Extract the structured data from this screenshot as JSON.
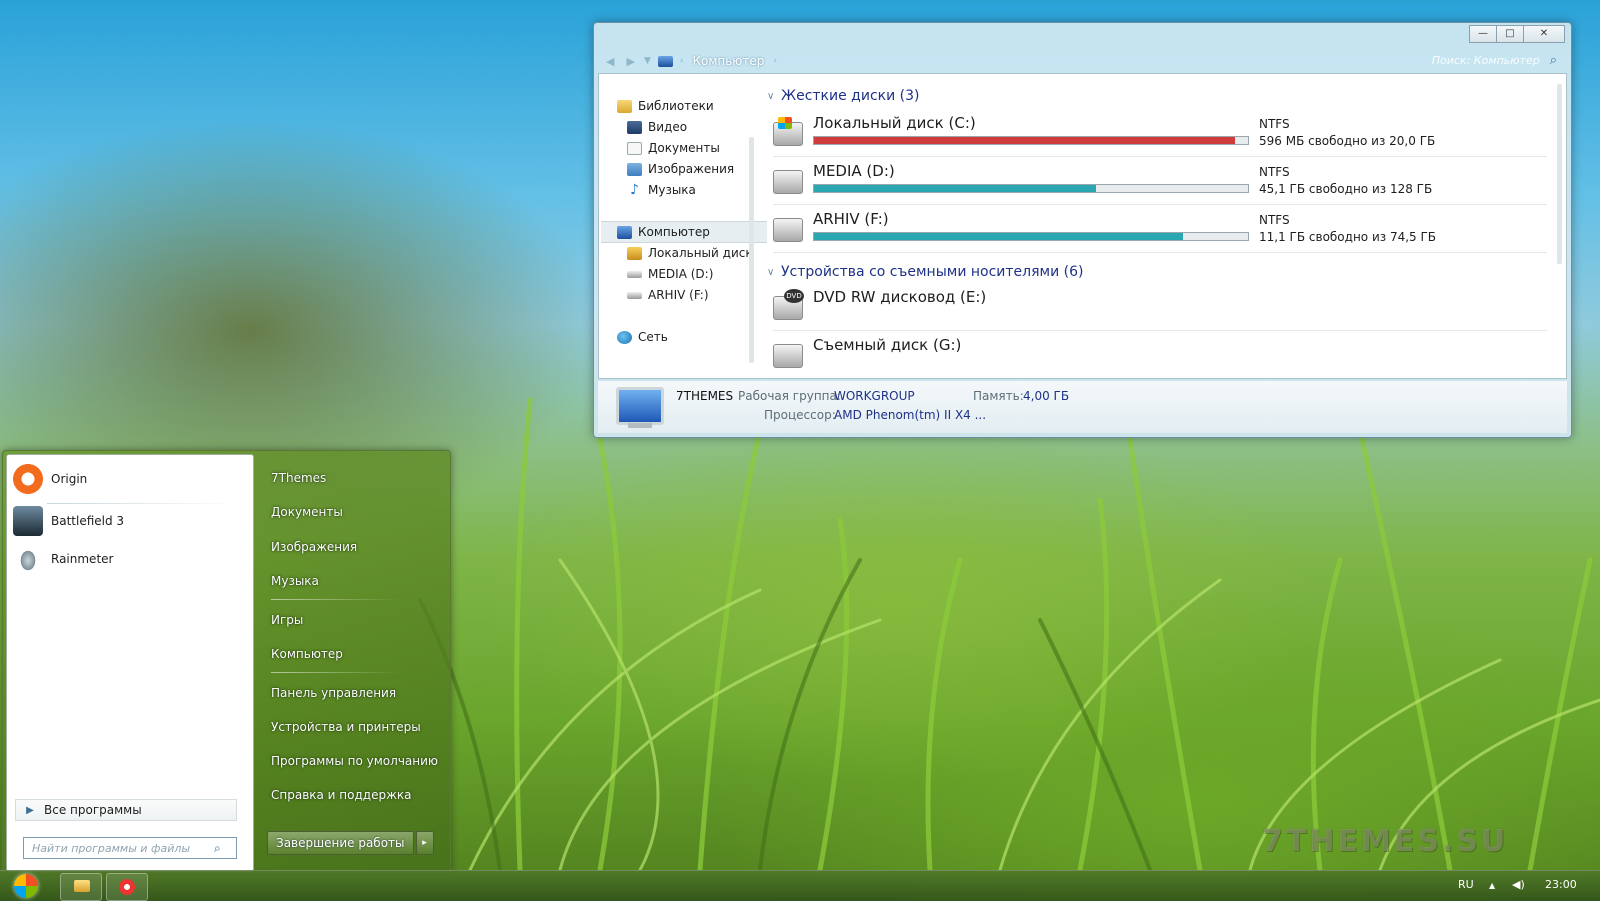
{
  "explorer": {
    "window_buttons": {
      "minimize": "—",
      "maximize": "□",
      "close": "✕"
    },
    "breadcrumb": "Компьютер",
    "search_placeholder": "Поиск: Компьютер",
    "nav": {
      "libraries": "Библиотеки",
      "video": "Видео",
      "documents": "Документы",
      "images": "Изображения",
      "music": "Музыка",
      "computer": "Компьютер",
      "local_disk": "Локальный диск (",
      "media": "MEDIA (D:)",
      "arhiv": "ARHIV (F:)",
      "network": "Сеть"
    },
    "hard_drives_header": "Жесткие диски (3)",
    "drives": [
      {
        "name": "Локальный диск (C:)",
        "fs": "NTFS",
        "free": "596 МБ свободно из 20,0 ГБ",
        "used_fraction": 0.97,
        "bar_color": "#d03c3c"
      },
      {
        "name": "MEDIA (D:)",
        "fs": "NTFS",
        "free": "45,1 ГБ свободно из 128 ГБ",
        "used_fraction": 0.65,
        "bar_color": "#2aa7b0"
      },
      {
        "name": "ARHIV (F:)",
        "fs": "NTFS",
        "free": "11,1 ГБ свободно из 74,5 ГБ",
        "used_fraction": 0.85,
        "bar_color": "#2aa7b0"
      }
    ],
    "removable_header": "Устройства со съемными носителями (6)",
    "removable": [
      {
        "name": "DVD RW дисковод (E:)"
      },
      {
        "name": "Съемный диск (G:)"
      }
    ],
    "details": {
      "pc_name": "7THEMES",
      "workgroup_label": "Рабочая группа:",
      "workgroup_value": "WORKGROUP",
      "memory_label": "Память:",
      "memory_value": "4,00 ГБ",
      "cpu_label": "Процессор:",
      "cpu_value": "AMD Phenom(tm) II X4 ..."
    }
  },
  "start_menu": {
    "programs": [
      "Origin",
      "Battlefield 3",
      "Rainmeter"
    ],
    "all_programs": "Все программы",
    "search_placeholder": "Найти программы и файлы",
    "links": {
      "user": "7Themes",
      "documents": "Документы",
      "images": "Изображения",
      "music": "Музыка",
      "games": "Игры",
      "computer": "Компьютер",
      "control_panel": "Панель управления",
      "devices": "Устройства и принтеры",
      "defaults": "Программы по умолчанию",
      "help": "Справка и поддержка"
    },
    "shutdown": "Завершение работы",
    "shutdown_arrow": "▸"
  },
  "watermark": "7THEMES.SU",
  "taskbar": {
    "language": "RU",
    "tray_arrow": "▲",
    "volume": "◀)",
    "time": "23:00"
  }
}
